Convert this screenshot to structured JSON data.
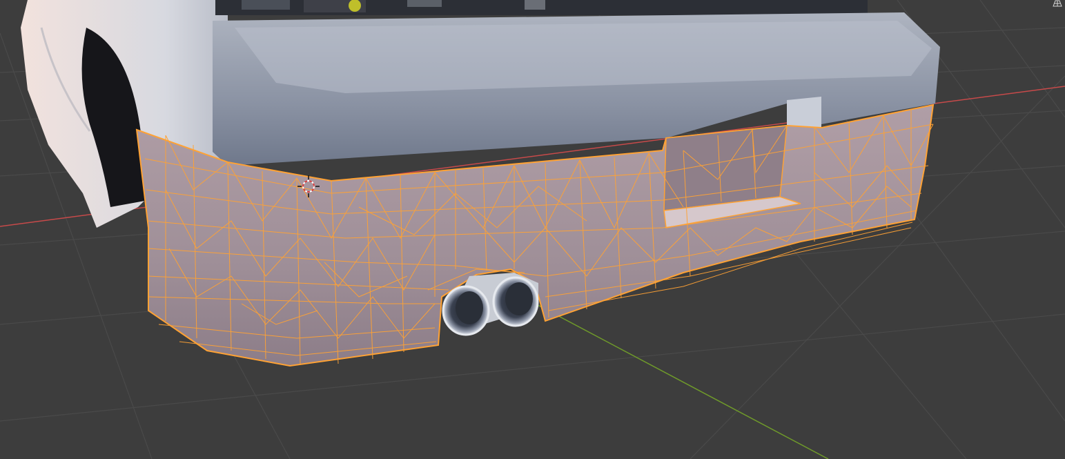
{
  "app": "3D viewport",
  "viewport": {
    "mode": "edit-mode",
    "selected_object": "rear-bumper",
    "background_color": "#3d3d3d",
    "grid_color": "#4a4a4a",
    "x_axis_color": "#c84a4a",
    "y_axis_color": "#6f9a2a",
    "selection_color": "#ffa234",
    "icons": {
      "corner": "navigation-gizmo-icon",
      "cursor": "3d-cursor-icon"
    }
  }
}
